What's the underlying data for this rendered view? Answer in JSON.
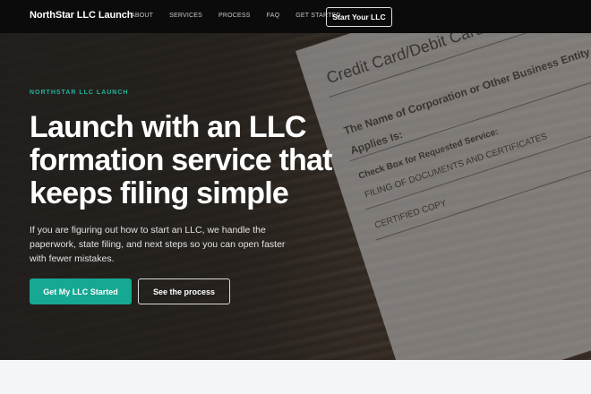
{
  "nav": {
    "brand": "NorthStar LLC Launch",
    "links": [
      "ABOUT",
      "SERVICES",
      "PROCESS",
      "FAQ",
      "GET STARTED"
    ],
    "cta": "Start Your LLC"
  },
  "hero": {
    "eyebrow": "NORTHSTAR LLC LAUNCH",
    "headline": "Launch with an LLC formation service that keeps filing simple",
    "subcopy": "If you are figuring out how to start an LLC, we handle the paperwork, state filing, and next steps so you can open faster with fewer mistakes.",
    "primary_button": "Get My LLC Started",
    "secondary_button": "See the process"
  },
  "background_image": {
    "lines": [
      "Credit Card/Debit Card Authorization",
      "The Name of Corporation or Other Business Entity To Which This Service",
      "Applies Is:",
      "Check Box for Requested Service:",
      "FILING OF DOCUMENTS AND CERTIFICATES",
      "CERTIFIED COPY"
    ]
  },
  "colors": {
    "accent": "#16a892",
    "eyebrow": "#1fb39b",
    "nav_bg": "#0b0b0b"
  }
}
